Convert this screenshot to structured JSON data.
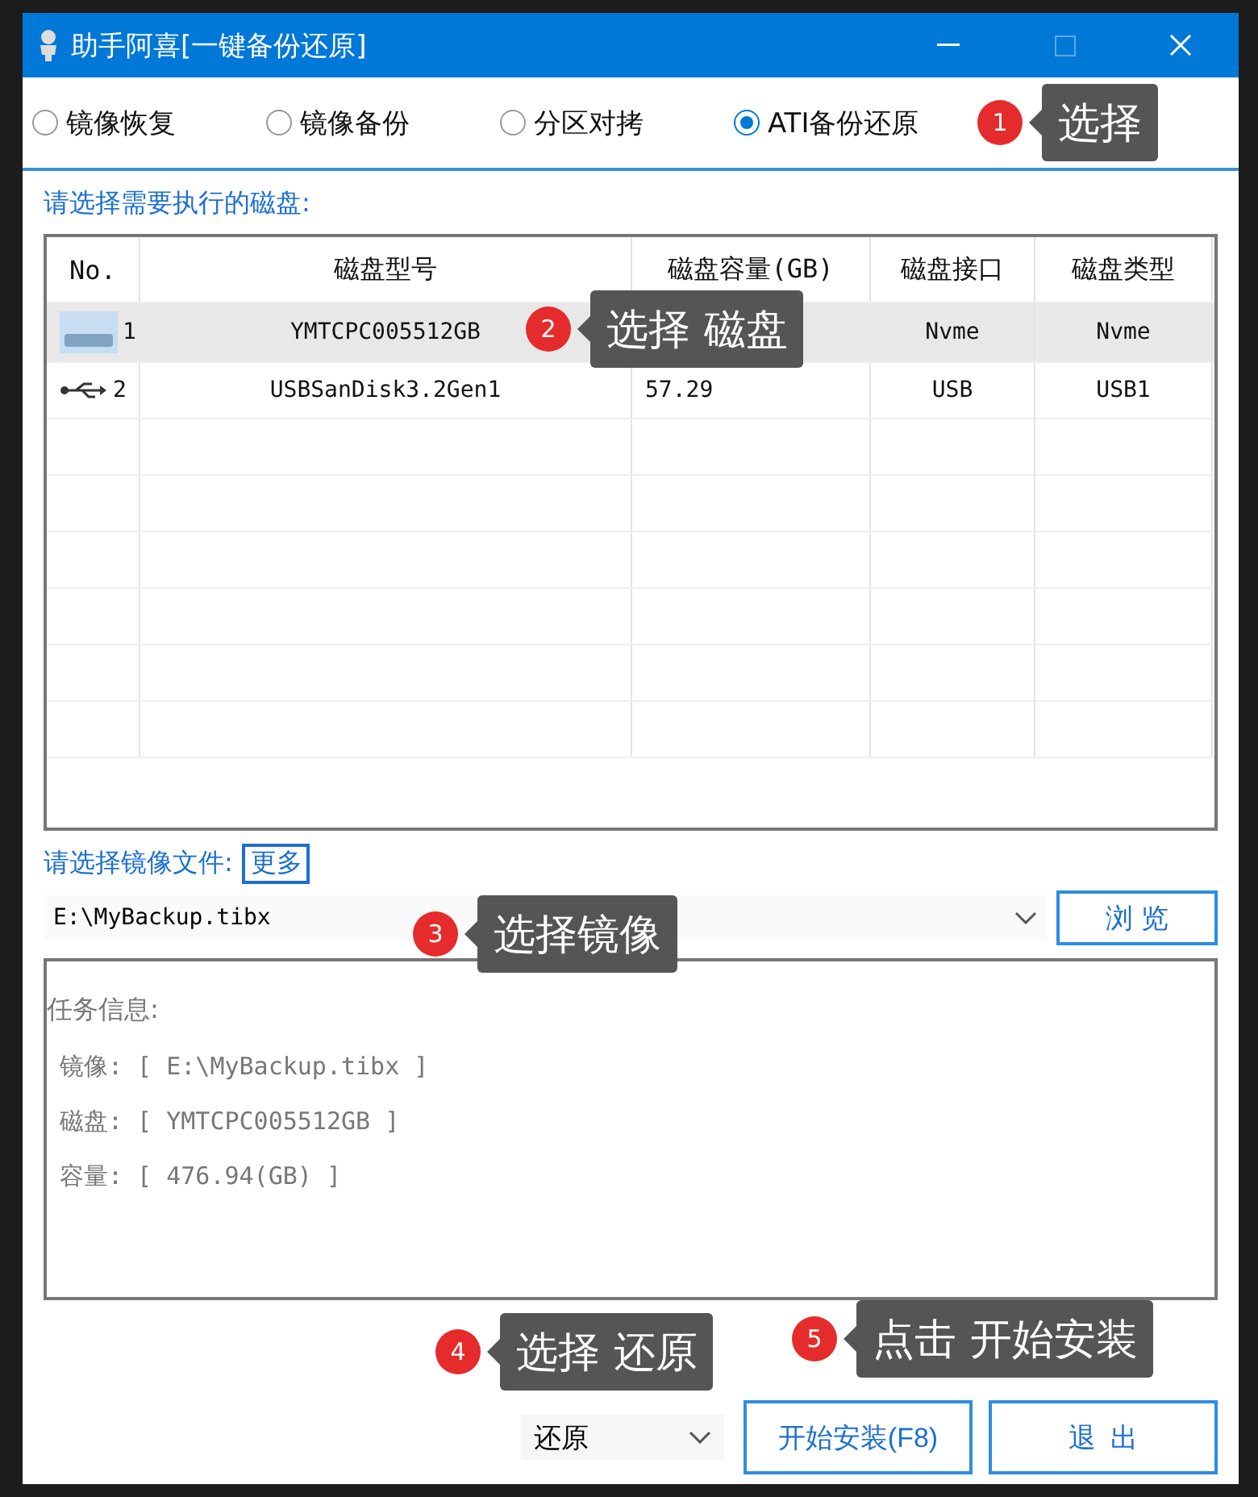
{
  "window": {
    "title": "助手阿喜[一键备份还原]"
  },
  "modes": [
    {
      "label": "镜像恢复",
      "selected": false
    },
    {
      "label": "镜像备份",
      "selected": false
    },
    {
      "label": "分区对拷",
      "selected": false
    },
    {
      "label": "ATI备份还原",
      "selected": true
    }
  ],
  "disk_prompt": "请选择需要执行的磁盘:",
  "table": {
    "columns": [
      "No.",
      "磁盘型号",
      "磁盘容量(GB)",
      "磁盘接口",
      "磁盘类型"
    ],
    "rows": [
      {
        "kind": "drive",
        "no": "1",
        "model": "YMTCPC005512GB",
        "interface": "Nvme",
        "type": "Nvme",
        "selected": true
      },
      {
        "kind": "usb",
        "no": "2",
        "model": "USBSanDisk3.2Gen1",
        "capacity": "57.29",
        "interface": "USB",
        "type": "USB1",
        "selected": false
      }
    ]
  },
  "image_prompt": "请选择镜像文件:",
  "more_link": "更多",
  "image_path": "E:\\MyBackup.tibx",
  "browse_button": "浏 览",
  "task_info": {
    "title": "任务信息:",
    "lines": [
      "镜像: [ E:\\MyBackup.tibx ]",
      "磁盘: [ YMTCPC005512GB ]",
      "容量: [ 476.94(GB) ]"
    ]
  },
  "action_select": "还原",
  "start_button": "开始安装(F8)",
  "exit_button": "退  出",
  "callouts": [
    {
      "number": "1",
      "text": "选择"
    },
    {
      "number": "2",
      "text": "选择 磁盘"
    },
    {
      "number": "3",
      "text": "选择镜像"
    },
    {
      "number": "4",
      "text": "选择 还原"
    },
    {
      "number": "5",
      "text": "点击 开始安装"
    }
  ]
}
